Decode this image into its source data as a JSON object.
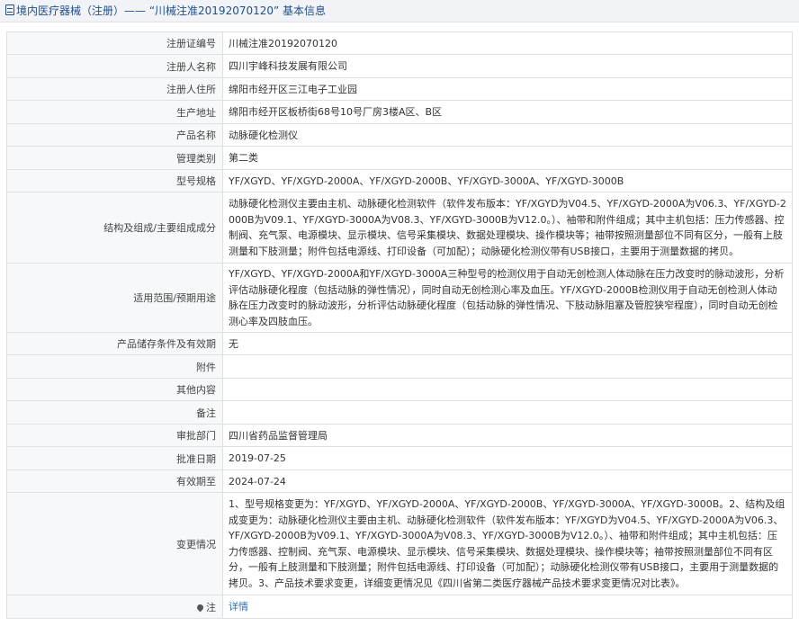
{
  "header": {
    "icon": "document-icon",
    "title": "境内医疗器械（注册）—— “川械注准20192070120” 基本信息"
  },
  "rows": [
    {
      "label": "注册证编号",
      "value": "川械注准20192070120"
    },
    {
      "label": "注册人名称",
      "value": "四川宇峰科技发展有限公司"
    },
    {
      "label": "注册人住所",
      "value": "绵阳市经开区三江电子工业园"
    },
    {
      "label": "生产地址",
      "value": "绵阳市经开区板桥街68号10号厂房3楼A区、B区"
    },
    {
      "label": "产品名称",
      "value": "动脉硬化检测仪"
    },
    {
      "label": "管理类别",
      "value": "第二类"
    },
    {
      "label": "型号规格",
      "value": "YF/XGYD、YF/XGYD-2000A、YF/XGYD-2000B、YF/XGYD-3000A、YF/XGYD-3000B"
    },
    {
      "label": "结构及组成/主要组成成分",
      "value": "动脉硬化检测仪主要由主机、动脉硬化检测软件（软件发布版本：YF/XGYD为V04.5、YF/XGYD-2000A为V06.3、YF/XGYD-2000B为V09.1、YF/XGYD-3000A为V08.3、YF/XGYD-3000B为V12.0。）、袖带和附件组成；其中主机包括：压力传感器、控制阀、充气泵、电源模块、显示模块、信号采集模块、数据处理模块、操作模块等；袖带按照测量部位不同有区分，一般有上肢测量和下肢测量；附件包括电源线、打印设备（可加配）；动脉硬化检测仪带有USB接口，主要用于测量数据的拷贝。"
    },
    {
      "label": "适用范围/预期用途",
      "value": "YF/XGYD、YF/XGYD-2000A和YF/XGYD-3000A三种型号的检测仪用于自动无创检测人体动脉在压力改变时的脉动波形，分析评估动脉硬化程度（包括动脉的弹性情况），同时自动无创检测心率及血压。YF/XGYD-2000B检测仪用于自动无创检测人体动脉在压力改变时的脉动波形，分析评估动脉硬化程度（包括动脉的弹性情况、下肢动脉阻塞及管腔狭窄程度），同时自动无创检测心率及四肢血压。"
    },
    {
      "label": "产品储存条件及有效期",
      "value": "无"
    },
    {
      "label": "附件",
      "value": ""
    },
    {
      "label": "其他内容",
      "value": ""
    },
    {
      "label": "备注",
      "value": ""
    },
    {
      "label": "审批部门",
      "value": "四川省药品监督管理局"
    },
    {
      "label": "批准日期",
      "value": "2019-07-25"
    },
    {
      "label": "有效期至",
      "value": "2024-07-24"
    },
    {
      "label": "变更情况",
      "value": "1、型号规格变更为：YF/XGYD、YF/XGYD-2000A、YF/XGYD-2000B、YF/XGYD-3000A、YF/XGYD-3000B。2、结构及组成变更为：动脉硬化检测仪主要由主机、动脉硬化检测软件（软件发布版本：YF/XGYD为V04.5、YF/XGYD-2000A为V06.3、YF/XGYD-2000B为V09.1、YF/XGYD-3000A为V08.3、YF/XGYD-3000B为V12.0。）、袖带和附件组成；其中主机包括：压力传感器、控制阀、充气泵、电源模块、显示模块、信号采集模块、数据处理模块、操作模块等；袖带按照测量部位不同有区分，一般有上肢测量和下肢测量；附件包括电源线、打印设备（可加配）；动脉硬化检测仪带有USB接口，主要用于测量数据的拷贝。3、产品技术要求变更，详细变更情况见《四川省第二类医疗器械产品技术要求变更情况对比表》。"
    },
    {
      "label": "注",
      "value": "详情",
      "icon": "pin-icon"
    }
  ]
}
